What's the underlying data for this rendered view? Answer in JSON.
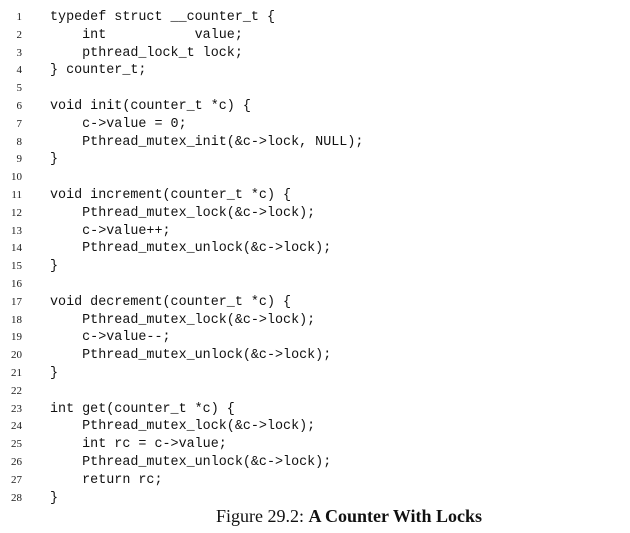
{
  "listing": {
    "lines": [
      {
        "number": "1",
        "code": "typedef struct __counter_t {"
      },
      {
        "number": "2",
        "code": "    int           value;"
      },
      {
        "number": "3",
        "code": "    pthread_lock_t lock;"
      },
      {
        "number": "4",
        "code": "} counter_t;"
      },
      {
        "number": "5",
        "code": ""
      },
      {
        "number": "6",
        "code": "void init(counter_t *c) {"
      },
      {
        "number": "7",
        "code": "    c->value = 0;"
      },
      {
        "number": "8",
        "code": "    Pthread_mutex_init(&c->lock, NULL);"
      },
      {
        "number": "9",
        "code": "}"
      },
      {
        "number": "10",
        "code": ""
      },
      {
        "number": "11",
        "code": "void increment(counter_t *c) {"
      },
      {
        "number": "12",
        "code": "    Pthread_mutex_lock(&c->lock);"
      },
      {
        "number": "13",
        "code": "    c->value++;"
      },
      {
        "number": "14",
        "code": "    Pthread_mutex_unlock(&c->lock);"
      },
      {
        "number": "15",
        "code": "}"
      },
      {
        "number": "16",
        "code": ""
      },
      {
        "number": "17",
        "code": "void decrement(counter_t *c) {"
      },
      {
        "number": "18",
        "code": "    Pthread_mutex_lock(&c->lock);"
      },
      {
        "number": "19",
        "code": "    c->value--;"
      },
      {
        "number": "20",
        "code": "    Pthread_mutex_unlock(&c->lock);"
      },
      {
        "number": "21",
        "code": "}"
      },
      {
        "number": "22",
        "code": ""
      },
      {
        "number": "23",
        "code": "int get(counter_t *c) {"
      },
      {
        "number": "24",
        "code": "    Pthread_mutex_lock(&c->lock);"
      },
      {
        "number": "25",
        "code": "    int rc = c->value;"
      },
      {
        "number": "26",
        "code": "    Pthread_mutex_unlock(&c->lock);"
      },
      {
        "number": "27",
        "code": "    return rc;"
      },
      {
        "number": "28",
        "code": "}"
      }
    ]
  },
  "caption": {
    "label": "Figure 29.2:",
    "title": "A Counter With Locks"
  }
}
